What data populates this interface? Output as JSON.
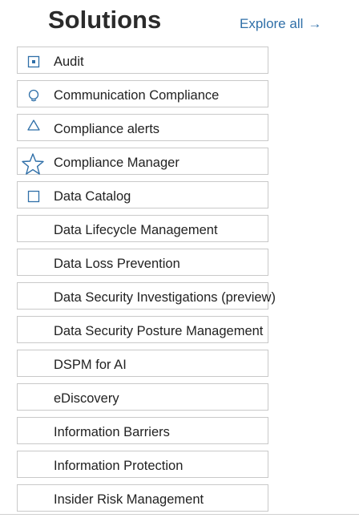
{
  "header": {
    "title": "Solutions",
    "explore_label": "Explore all",
    "explore_arrow": "→"
  },
  "solutions": [
    {
      "label": "Audit",
      "icon": "audit-icon"
    },
    {
      "label": "Communication Compliance",
      "icon": "communication-compliance-icon"
    },
    {
      "label": "Compliance alerts",
      "icon": "alert-icon"
    },
    {
      "label": "Compliance Manager",
      "icon": "star-icon"
    },
    {
      "label": "Data Catalog",
      "icon": "catalog-icon"
    },
    {
      "label": "Data Lifecycle Management",
      "icon": ""
    },
    {
      "label": "Data Loss Prevention",
      "icon": ""
    },
    {
      "label": "Data Security Investigations (preview)",
      "icon": ""
    },
    {
      "label": "Data Security Posture Management",
      "icon": ""
    },
    {
      "label": "DSPM for AI",
      "icon": ""
    },
    {
      "label": "eDiscovery",
      "icon": ""
    },
    {
      "label": "Information Barriers",
      "icon": ""
    },
    {
      "label": "Information Protection",
      "icon": ""
    },
    {
      "label": "Insider Risk Management",
      "icon": ""
    }
  ],
  "colors": {
    "link": "#2f6fa8",
    "icon": "#2f6fa8",
    "border": "#c9c9c9"
  }
}
